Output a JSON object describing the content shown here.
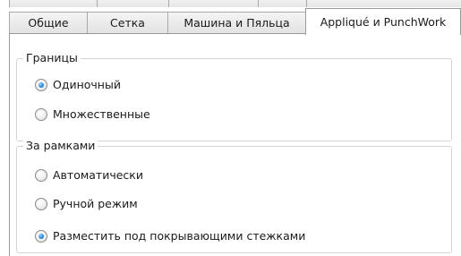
{
  "tabs": [
    {
      "label": "Общие"
    },
    {
      "label": "Сетка"
    },
    {
      "label": "Машина и Пяльца"
    },
    {
      "label": "Appliqué и PunchWork",
      "active": true
    }
  ],
  "borders_group": {
    "title": "Границы",
    "options": [
      {
        "label": "Одиночный",
        "checked": true
      },
      {
        "label": "Множественные",
        "checked": false
      }
    ]
  },
  "outside_group": {
    "title": "За рамками",
    "options": [
      {
        "label": "Автоматически",
        "checked": false
      },
      {
        "label": "Ручной режим",
        "checked": false
      },
      {
        "label": "Разместить под покрывающими стежками",
        "checked": true
      }
    ]
  },
  "colors": {
    "radio_selected": "#2c8ae0",
    "border": "#a9a9a9",
    "group_border": "#d4d4d4"
  },
  "icons": [
    "radio-selected-icon",
    "radio-unselected-icon"
  ]
}
